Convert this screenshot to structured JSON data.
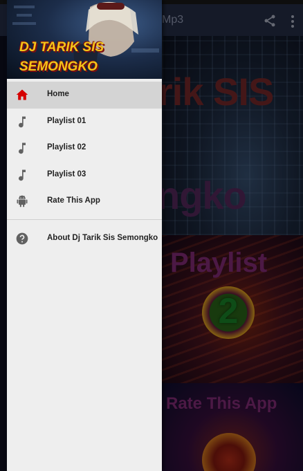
{
  "app": {
    "appbar_title": "Mp3",
    "banners": {
      "banner1_line1": "rik SIS",
      "banner1_line2": "ngko",
      "banner2_title": "Playlist",
      "banner2_number": "2",
      "banner3_title": "Rate This App"
    }
  },
  "drawer": {
    "header": {
      "title_line1": "DJ TARIK SIS",
      "title_line2": "SEMONGKO"
    },
    "items": [
      {
        "label": "Home",
        "icon": "home-icon",
        "active": true
      },
      {
        "label": "Playlist 01",
        "icon": "music-note-icon"
      },
      {
        "label": "Playlist 02",
        "icon": "music-note-icon"
      },
      {
        "label": "Playlist 03",
        "icon": "music-note-icon"
      },
      {
        "label": "Rate This App",
        "icon": "android-icon"
      }
    ],
    "secondary_items": [
      {
        "label": "About Dj Tarik Sis Semongko",
        "icon": "help-icon"
      }
    ]
  },
  "colors": {
    "accent": "#d50000",
    "drawer_bg": "#eeeeee",
    "active_item_bg": "#d4d4d4",
    "appbar": "#27304a"
  }
}
